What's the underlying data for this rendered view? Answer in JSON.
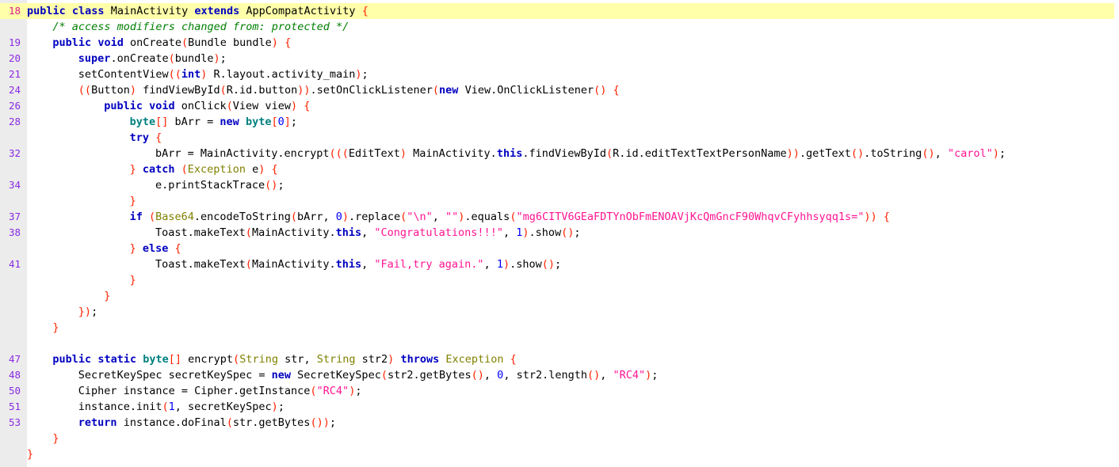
{
  "viewer": {
    "name": "decompiled-java-source-viewer",
    "language": "java",
    "highlighted_line": 18,
    "colors": {
      "background": "#ffffff",
      "gutter": "#ececec",
      "line_number": "#8a2be2",
      "line_number_highlighted": "#d81b8c",
      "highlight_row": "#ffffaa",
      "keyword": "#0000c0",
      "type": "#808000",
      "primitive": "#008080",
      "comment": "#008000",
      "string": "#ff1493",
      "number": "#0000ff",
      "punctuation": "#ff2200",
      "plain": "#000000"
    }
  },
  "lines": [
    {
      "number": "18",
      "highlighted": true,
      "indent": 0,
      "tokens": [
        {
          "t": "kw",
          "v": "public"
        },
        {
          "t": "pln",
          "v": " "
        },
        {
          "t": "kw",
          "v": "class"
        },
        {
          "t": "pln",
          "v": " MainActivity "
        },
        {
          "t": "kw",
          "v": "extends"
        },
        {
          "t": "pln",
          "v": " AppCompatActivity "
        },
        {
          "t": "pun",
          "v": "{"
        }
      ]
    },
    {
      "number": "",
      "highlighted": false,
      "indent": 4,
      "tokens": [
        {
          "t": "cmt",
          "v": "/* access modifiers changed from: protected */"
        }
      ]
    },
    {
      "number": "19",
      "highlighted": false,
      "indent": 4,
      "tokens": [
        {
          "t": "kw",
          "v": "public"
        },
        {
          "t": "pln",
          "v": " "
        },
        {
          "t": "kw",
          "v": "void"
        },
        {
          "t": "pln",
          "v": " onCreate"
        },
        {
          "t": "pun",
          "v": "("
        },
        {
          "t": "pln",
          "v": "Bundle bundle"
        },
        {
          "t": "pun",
          "v": ")"
        },
        {
          "t": "pln",
          "v": " "
        },
        {
          "t": "pun",
          "v": "{"
        }
      ]
    },
    {
      "number": "20",
      "highlighted": false,
      "indent": 8,
      "tokens": [
        {
          "t": "kw",
          "v": "super"
        },
        {
          "t": "pln",
          "v": ".onCreate"
        },
        {
          "t": "pun",
          "v": "("
        },
        {
          "t": "pln",
          "v": "bundle"
        },
        {
          "t": "pun",
          "v": ")"
        },
        {
          "t": "pln",
          "v": ";"
        }
      ]
    },
    {
      "number": "21",
      "highlighted": false,
      "indent": 8,
      "tokens": [
        {
          "t": "pln",
          "v": "setContentView"
        },
        {
          "t": "pun",
          "v": "(("
        },
        {
          "t": "kw",
          "v": "int"
        },
        {
          "t": "pun",
          "v": ")"
        },
        {
          "t": "pln",
          "v": " R.layout.activity_main"
        },
        {
          "t": "pun",
          "v": ")"
        },
        {
          "t": "pln",
          "v": ";"
        }
      ]
    },
    {
      "number": "24",
      "highlighted": false,
      "indent": 8,
      "tokens": [
        {
          "t": "pun",
          "v": "(("
        },
        {
          "t": "pln",
          "v": "Button"
        },
        {
          "t": "pun",
          "v": ")"
        },
        {
          "t": "pln",
          "v": " findViewById"
        },
        {
          "t": "pun",
          "v": "("
        },
        {
          "t": "pln",
          "v": "R.id.button"
        },
        {
          "t": "pun",
          "v": "))"
        },
        {
          "t": "pln",
          "v": ".setOnClickListener"
        },
        {
          "t": "pun",
          "v": "("
        },
        {
          "t": "kw",
          "v": "new"
        },
        {
          "t": "pln",
          "v": " View.OnClickListener"
        },
        {
          "t": "pun",
          "v": "()"
        },
        {
          "t": "pln",
          "v": " "
        },
        {
          "t": "pun",
          "v": "{"
        }
      ]
    },
    {
      "number": "26",
      "highlighted": false,
      "indent": 12,
      "tokens": [
        {
          "t": "kw",
          "v": "public"
        },
        {
          "t": "pln",
          "v": " "
        },
        {
          "t": "kw",
          "v": "void"
        },
        {
          "t": "pln",
          "v": " onClick"
        },
        {
          "t": "pun",
          "v": "("
        },
        {
          "t": "pln",
          "v": "View view"
        },
        {
          "t": "pun",
          "v": ")"
        },
        {
          "t": "pln",
          "v": " "
        },
        {
          "t": "pun",
          "v": "{"
        }
      ]
    },
    {
      "number": "28",
      "highlighted": false,
      "indent": 16,
      "tokens": [
        {
          "t": "prim",
          "v": "byte"
        },
        {
          "t": "pun",
          "v": "[]"
        },
        {
          "t": "pln",
          "v": " bArr = "
        },
        {
          "t": "kw",
          "v": "new"
        },
        {
          "t": "pln",
          "v": " "
        },
        {
          "t": "prim",
          "v": "byte"
        },
        {
          "t": "pun",
          "v": "["
        },
        {
          "t": "num",
          "v": "0"
        },
        {
          "t": "pun",
          "v": "]"
        },
        {
          "t": "pln",
          "v": ";"
        }
      ]
    },
    {
      "number": "",
      "highlighted": false,
      "indent": 16,
      "tokens": [
        {
          "t": "kw",
          "v": "try"
        },
        {
          "t": "pln",
          "v": " "
        },
        {
          "t": "pun",
          "v": "{"
        }
      ]
    },
    {
      "number": "32",
      "highlighted": false,
      "indent": 20,
      "tokens": [
        {
          "t": "pln",
          "v": "bArr = MainActivity.encrypt"
        },
        {
          "t": "pun",
          "v": "((("
        },
        {
          "t": "pln",
          "v": "EditText"
        },
        {
          "t": "pun",
          "v": ")"
        },
        {
          "t": "pln",
          "v": " MainActivity."
        },
        {
          "t": "kw",
          "v": "this"
        },
        {
          "t": "pln",
          "v": ".findViewById"
        },
        {
          "t": "pun",
          "v": "("
        },
        {
          "t": "pln",
          "v": "R.id.editTextTextPersonName"
        },
        {
          "t": "pun",
          "v": "))"
        },
        {
          "t": "pln",
          "v": ".getText"
        },
        {
          "t": "pun",
          "v": "()"
        },
        {
          "t": "pln",
          "v": ".toString"
        },
        {
          "t": "pun",
          "v": "()"
        },
        {
          "t": "pln",
          "v": ", "
        },
        {
          "t": "str",
          "v": "\"carol\""
        },
        {
          "t": "pun",
          "v": ")"
        },
        {
          "t": "pln",
          "v": ";"
        }
      ]
    },
    {
      "number": "",
      "highlighted": false,
      "indent": 16,
      "tokens": [
        {
          "t": "pun",
          "v": "}"
        },
        {
          "t": "pln",
          "v": " "
        },
        {
          "t": "kw",
          "v": "catch"
        },
        {
          "t": "pln",
          "v": " "
        },
        {
          "t": "pun",
          "v": "("
        },
        {
          "t": "typ",
          "v": "Exception"
        },
        {
          "t": "pln",
          "v": " e"
        },
        {
          "t": "pun",
          "v": ")"
        },
        {
          "t": "pln",
          "v": " "
        },
        {
          "t": "pun",
          "v": "{"
        }
      ]
    },
    {
      "number": "34",
      "highlighted": false,
      "indent": 20,
      "tokens": [
        {
          "t": "pln",
          "v": "e.printStackTrace"
        },
        {
          "t": "pun",
          "v": "()"
        },
        {
          "t": "pln",
          "v": ";"
        }
      ]
    },
    {
      "number": "",
      "highlighted": false,
      "indent": 16,
      "tokens": [
        {
          "t": "pun",
          "v": "}"
        }
      ]
    },
    {
      "number": "37",
      "highlighted": false,
      "indent": 16,
      "tokens": [
        {
          "t": "kw",
          "v": "if"
        },
        {
          "t": "pln",
          "v": " "
        },
        {
          "t": "pun",
          "v": "("
        },
        {
          "t": "typ",
          "v": "Base64"
        },
        {
          "t": "pln",
          "v": ".encodeToString"
        },
        {
          "t": "pun",
          "v": "("
        },
        {
          "t": "pln",
          "v": "bArr, "
        },
        {
          "t": "num",
          "v": "0"
        },
        {
          "t": "pun",
          "v": ")"
        },
        {
          "t": "pln",
          "v": ".replace"
        },
        {
          "t": "pun",
          "v": "("
        },
        {
          "t": "str",
          "v": "\"\\n\""
        },
        {
          "t": "pln",
          "v": ", "
        },
        {
          "t": "str",
          "v": "\"\""
        },
        {
          "t": "pun",
          "v": ")"
        },
        {
          "t": "pln",
          "v": ".equals"
        },
        {
          "t": "pun",
          "v": "("
        },
        {
          "t": "str",
          "v": "\"mg6CITV6GEaFDTYnObFmENOAVjKcQmGncF90WhqvCFyhhsyqq1s=\""
        },
        {
          "t": "pun",
          "v": "))"
        },
        {
          "t": "pln",
          "v": " "
        },
        {
          "t": "pun",
          "v": "{"
        }
      ]
    },
    {
      "number": "38",
      "highlighted": false,
      "indent": 20,
      "tokens": [
        {
          "t": "pln",
          "v": "Toast.makeText"
        },
        {
          "t": "pun",
          "v": "("
        },
        {
          "t": "pln",
          "v": "MainActivity."
        },
        {
          "t": "kw",
          "v": "this"
        },
        {
          "t": "pln",
          "v": ", "
        },
        {
          "t": "str",
          "v": "\"Congratulations!!!\""
        },
        {
          "t": "pln",
          "v": ", "
        },
        {
          "t": "num",
          "v": "1"
        },
        {
          "t": "pun",
          "v": ")"
        },
        {
          "t": "pln",
          "v": ".show"
        },
        {
          "t": "pun",
          "v": "()"
        },
        {
          "t": "pln",
          "v": ";"
        }
      ]
    },
    {
      "number": "",
      "highlighted": false,
      "indent": 16,
      "tokens": [
        {
          "t": "pun",
          "v": "}"
        },
        {
          "t": "pln",
          "v": " "
        },
        {
          "t": "kw",
          "v": "else"
        },
        {
          "t": "pln",
          "v": " "
        },
        {
          "t": "pun",
          "v": "{"
        }
      ]
    },
    {
      "number": "41",
      "highlighted": false,
      "indent": 20,
      "tokens": [
        {
          "t": "pln",
          "v": "Toast.makeText"
        },
        {
          "t": "pun",
          "v": "("
        },
        {
          "t": "pln",
          "v": "MainActivity."
        },
        {
          "t": "kw",
          "v": "this"
        },
        {
          "t": "pln",
          "v": ", "
        },
        {
          "t": "str",
          "v": "\"Fail,try again.\""
        },
        {
          "t": "pln",
          "v": ", "
        },
        {
          "t": "num",
          "v": "1"
        },
        {
          "t": "pun",
          "v": ")"
        },
        {
          "t": "pln",
          "v": ".show"
        },
        {
          "t": "pun",
          "v": "()"
        },
        {
          "t": "pln",
          "v": ";"
        }
      ]
    },
    {
      "number": "",
      "highlighted": false,
      "indent": 16,
      "tokens": [
        {
          "t": "pun",
          "v": "}"
        }
      ]
    },
    {
      "number": "",
      "highlighted": false,
      "indent": 12,
      "tokens": [
        {
          "t": "pun",
          "v": "}"
        }
      ]
    },
    {
      "number": "",
      "highlighted": false,
      "indent": 8,
      "tokens": [
        {
          "t": "pun",
          "v": "})"
        },
        {
          "t": "pln",
          "v": ";"
        }
      ]
    },
    {
      "number": "",
      "highlighted": false,
      "indent": 4,
      "tokens": [
        {
          "t": "pun",
          "v": "}"
        }
      ]
    },
    {
      "number": "",
      "highlighted": false,
      "indent": 0,
      "tokens": []
    },
    {
      "number": "47",
      "highlighted": false,
      "indent": 4,
      "tokens": [
        {
          "t": "kw",
          "v": "public"
        },
        {
          "t": "pln",
          "v": " "
        },
        {
          "t": "kw",
          "v": "static"
        },
        {
          "t": "pln",
          "v": " "
        },
        {
          "t": "prim",
          "v": "byte"
        },
        {
          "t": "pun",
          "v": "[]"
        },
        {
          "t": "pln",
          "v": " encrypt"
        },
        {
          "t": "pun",
          "v": "("
        },
        {
          "t": "typ",
          "v": "String"
        },
        {
          "t": "pln",
          "v": " str, "
        },
        {
          "t": "typ",
          "v": "String"
        },
        {
          "t": "pln",
          "v": " str2"
        },
        {
          "t": "pun",
          "v": ")"
        },
        {
          "t": "pln",
          "v": " "
        },
        {
          "t": "kw",
          "v": "throws"
        },
        {
          "t": "pln",
          "v": " "
        },
        {
          "t": "typ",
          "v": "Exception"
        },
        {
          "t": "pln",
          "v": " "
        },
        {
          "t": "pun",
          "v": "{"
        }
      ]
    },
    {
      "number": "48",
      "highlighted": false,
      "indent": 8,
      "tokens": [
        {
          "t": "pln",
          "v": "SecretKeySpec secretKeySpec = "
        },
        {
          "t": "kw",
          "v": "new"
        },
        {
          "t": "pln",
          "v": " SecretKeySpec"
        },
        {
          "t": "pun",
          "v": "("
        },
        {
          "t": "pln",
          "v": "str2.getBytes"
        },
        {
          "t": "pun",
          "v": "()"
        },
        {
          "t": "pln",
          "v": ", "
        },
        {
          "t": "num",
          "v": "0"
        },
        {
          "t": "pln",
          "v": ", str2.length"
        },
        {
          "t": "pun",
          "v": "()"
        },
        {
          "t": "pln",
          "v": ", "
        },
        {
          "t": "str",
          "v": "\"RC4\""
        },
        {
          "t": "pun",
          "v": ")"
        },
        {
          "t": "pln",
          "v": ";"
        }
      ]
    },
    {
      "number": "50",
      "highlighted": false,
      "indent": 8,
      "tokens": [
        {
          "t": "pln",
          "v": "Cipher instance = Cipher.getInstance"
        },
        {
          "t": "pun",
          "v": "("
        },
        {
          "t": "str",
          "v": "\"RC4\""
        },
        {
          "t": "pun",
          "v": ")"
        },
        {
          "t": "pln",
          "v": ";"
        }
      ]
    },
    {
      "number": "51",
      "highlighted": false,
      "indent": 8,
      "tokens": [
        {
          "t": "pln",
          "v": "instance.init"
        },
        {
          "t": "pun",
          "v": "("
        },
        {
          "t": "num",
          "v": "1"
        },
        {
          "t": "pln",
          "v": ", secretKeySpec"
        },
        {
          "t": "pun",
          "v": ")"
        },
        {
          "t": "pln",
          "v": ";"
        }
      ]
    },
    {
      "number": "53",
      "highlighted": false,
      "indent": 8,
      "tokens": [
        {
          "t": "kw",
          "v": "return"
        },
        {
          "t": "pln",
          "v": " instance.doFinal"
        },
        {
          "t": "pun",
          "v": "("
        },
        {
          "t": "pln",
          "v": "str.getBytes"
        },
        {
          "t": "pun",
          "v": "())"
        },
        {
          "t": "pln",
          "v": ";"
        }
      ]
    },
    {
      "number": "",
      "highlighted": false,
      "indent": 4,
      "tokens": [
        {
          "t": "pun",
          "v": "}"
        }
      ]
    },
    {
      "number": "",
      "highlighted": false,
      "indent": 0,
      "tokens": [
        {
          "t": "pun",
          "v": "}"
        }
      ]
    }
  ]
}
